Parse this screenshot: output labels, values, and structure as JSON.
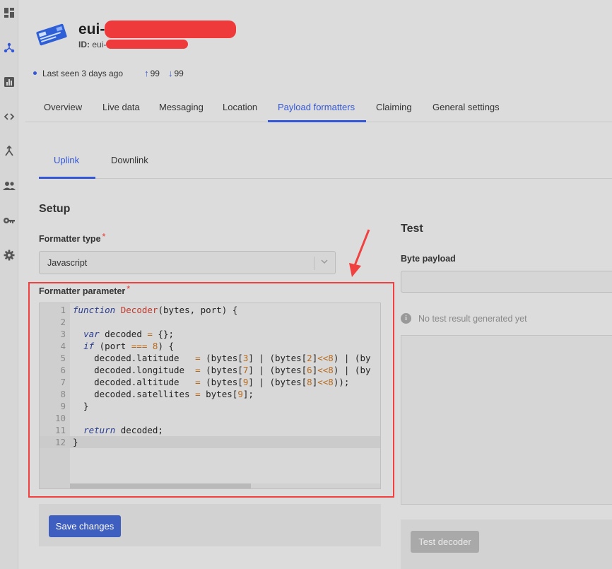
{
  "rail": {
    "icons": [
      "dashboard-icon",
      "network-icon",
      "bar-chart-icon",
      "code-icon",
      "merge-icon",
      "people-icon",
      "key-icon",
      "gear-icon"
    ],
    "active_color": "#3457d5"
  },
  "device": {
    "name": "eui-",
    "id_label": "ID:",
    "id_value": "eui-",
    "last_seen": "Last seen 3 days ago",
    "uplink_count": "99",
    "downlink_count": "99"
  },
  "tabs": [
    "Overview",
    "Live data",
    "Messaging",
    "Location",
    "Payload formatters",
    "Claiming",
    "General settings"
  ],
  "active_tab": "Payload formatters",
  "subtabs": [
    "Uplink",
    "Downlink"
  ],
  "active_subtab": "Uplink",
  "setup": {
    "title": "Setup",
    "formatter_type_label": "Formatter type",
    "formatter_type_value": "Javascript",
    "required_mark": "*",
    "formatter_parameter_label": "Formatter parameter"
  },
  "code_lines": [
    "function Decoder(bytes, port) {",
    "",
    "  var decoded = {};",
    "  if (port === 8) {",
    "    decoded.latitude   = (bytes[3] | (bytes[2]<<8) | (by",
    "    decoded.longitude  = (bytes[7] | (bytes[6]<<8) | (by",
    "    decoded.altitude   = (bytes[9] | (bytes[8]<<8));",
    "    decoded.satellites = bytes[9];",
    "  }",
    "",
    "  return decoded;",
    "}"
  ],
  "save_button": "Save changes",
  "test": {
    "title": "Test",
    "byte_payload_label": "Byte payload",
    "byte_payload_value": "",
    "no_result_text": "No test result generated yet",
    "test_button": "Test decoder"
  },
  "colors": {
    "accent": "#3457d5",
    "annotation_red": "#f04040",
    "save_button_bg": "#3f5fc0"
  }
}
